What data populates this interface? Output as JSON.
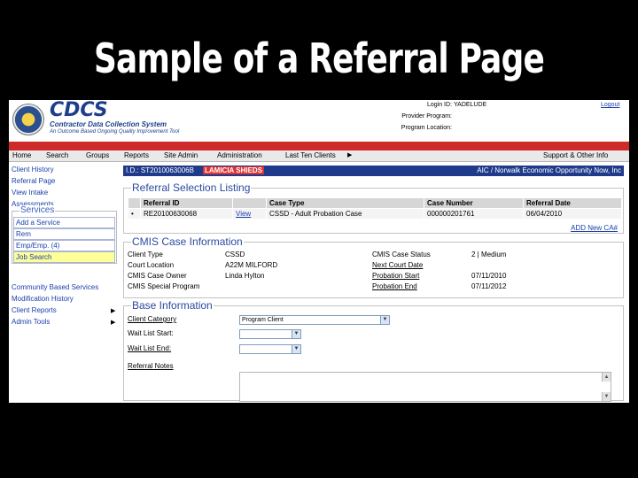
{
  "slide": {
    "title": "Sample of a Referral Page"
  },
  "header": {
    "logo_text": "CDCS",
    "logo_subtitle": "Contractor Data Collection System",
    "logo_tagline": "An Outcome Based Ongoing Quality Improvement Tool",
    "login_label": "Login ID:",
    "login_value": "YADELUDE",
    "provider_label": "Provider Program:",
    "program_location_label": "Program Location:",
    "logout_label": "Logout"
  },
  "menu": {
    "items": [
      "Home",
      "Search",
      "Groups",
      "Reports",
      "Site Admin",
      "Administration",
      "Last Ten Clients",
      "Support & Other Info"
    ]
  },
  "sidebar": {
    "links": [
      "Client History",
      "Referral Page",
      "View Intake",
      "Assessments"
    ],
    "services_title": "Services",
    "services": [
      "Add a Service",
      "Rem",
      "Emp/Emp. (4)",
      "Job Search"
    ],
    "lower_links": [
      "Community Based Services",
      "Modification History",
      "Client Reports",
      "Admin Tools"
    ]
  },
  "client_bar": {
    "id": "I.D.: ST2010063006B",
    "name": "LAMICIA SHIEDS",
    "org": "AIC / Norwalk Economic Opportunity Now, Inc"
  },
  "referral": {
    "title": "Referral Selection Listing",
    "columns": [
      "",
      "Referral ID",
      "",
      "Case Type",
      "Case Number",
      "Referral Date"
    ],
    "rows": [
      {
        "bullet": "•",
        "id": "RE20100630068",
        "view": "View",
        "case_type": "CSSD - Adult Probation Case",
        "case_number": "000000201761",
        "date": "06/04/2010"
      }
    ],
    "add_link": "ADD New CA#"
  },
  "cmis": {
    "title": "CMIS Case Information",
    "left": [
      {
        "label": "Client Type",
        "value": "CSSD"
      },
      {
        "label": "Court Location",
        "value": "A22M MILFORD"
      },
      {
        "label": "CMIS Case Owner",
        "value": "Linda Hylton"
      },
      {
        "label": "CMIS Special Program",
        "value": ""
      }
    ],
    "right": [
      {
        "label": "CMIS Case Status",
        "value": "2 | Medium"
      },
      {
        "label": "Next Court Date",
        "value": ""
      },
      {
        "label": "Probation Start",
        "value": "07/11/2010"
      },
      {
        "label": "Probation End",
        "value": "07/11/2012"
      }
    ]
  },
  "base": {
    "title": "Base Information",
    "client_category_label": "Client Category",
    "client_category_value": "Program Client",
    "wait_list_start_label": "Wait List Start:",
    "wait_list_end_label": "Wait List End:",
    "referral_notes_label": "Referral Notes"
  },
  "colors": {
    "accent": "#1f3a8a",
    "menu_red": "#cf2a2a",
    "highlight": "#ffff99"
  }
}
